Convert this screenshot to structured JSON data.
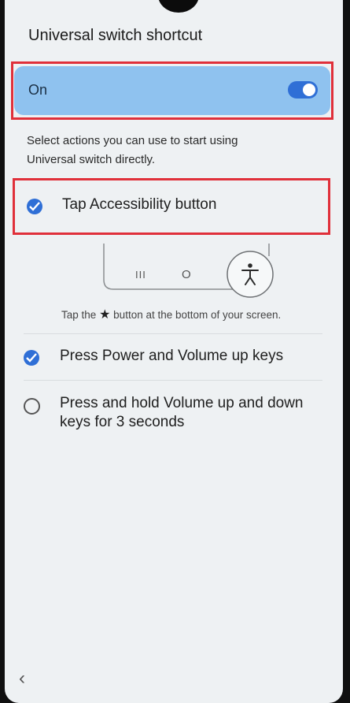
{
  "header": {
    "title": "Universal switch shortcut"
  },
  "master_switch": {
    "label": "On",
    "state": "on"
  },
  "description": "Select actions you can use to start using Universal switch directly.",
  "options": [
    {
      "label": "Tap Accessibility button",
      "checked": true
    },
    {
      "label": "Press Power and Volume up keys",
      "checked": true
    },
    {
      "label": "Press and hold Volume up and down keys for 3 seconds",
      "checked": false
    }
  ],
  "illustration": {
    "recents_glyph": "III",
    "home_glyph": "O",
    "accessibility_icon": "accessibility-icon"
  },
  "helper": {
    "prefix": "Tap the",
    "suffix": "button at the bottom of your screen.",
    "icon": "accessibility-icon"
  },
  "nav": {
    "back_icon": "back-chevron-icon"
  },
  "colors": {
    "accent": "#2f6fd6",
    "card": "#8fc2ef",
    "highlight": "#e0303a",
    "background": "#eef1f3"
  }
}
